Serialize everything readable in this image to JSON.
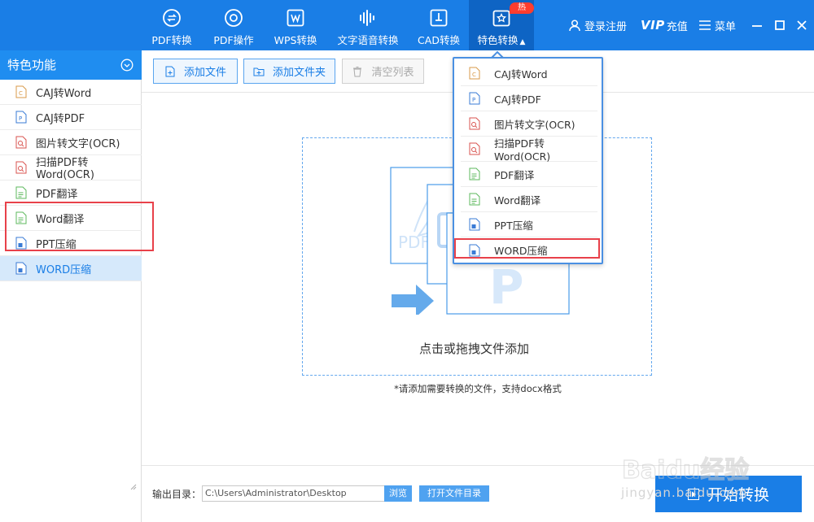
{
  "nav": {
    "items": [
      {
        "label": "PDF转换",
        "icon": "pdf-convert-icon"
      },
      {
        "label": "PDF操作",
        "icon": "pdf-operate-icon"
      },
      {
        "label": "WPS转换",
        "icon": "wps-convert-icon"
      },
      {
        "label": "文字语音转换",
        "icon": "audio-wave-icon"
      },
      {
        "label": "CAD转换",
        "icon": "cad-convert-icon"
      },
      {
        "label": "特色转换",
        "icon": "special-convert-icon"
      }
    ],
    "hot_badge": "热",
    "login": "登录注册",
    "vip": "VIP",
    "recharge": "充值",
    "menu": "菜单"
  },
  "sidebar": {
    "header": "特色功能",
    "items": [
      {
        "label": "CAJ转Word",
        "icon": "caj-file-icon"
      },
      {
        "label": "CAJ转PDF",
        "icon": "caj-pdf-file-icon"
      },
      {
        "label": "图片转文字(OCR)",
        "icon": "ocr-file-icon"
      },
      {
        "label": "扫描PDF转Word(OCR)",
        "icon": "scan-pdf-file-icon"
      },
      {
        "label": "PDF翻译",
        "icon": "pdf-translate-file-icon"
      },
      {
        "label": "Word翻译",
        "icon": "word-translate-file-icon"
      },
      {
        "label": "PPT压缩",
        "icon": "ppt-compress-file-icon"
      },
      {
        "label": "WORD压缩",
        "icon": "word-compress-file-icon"
      }
    ],
    "selected_index": 7
  },
  "toolbar": {
    "add_file": "添加文件",
    "add_folder": "添加文件夹",
    "clear_list": "清空列表"
  },
  "dropzone": {
    "text": "点击或拖拽文件添加",
    "hint": "*请添加需要转换的文件，支持docx格式",
    "illustration_label": "PDF"
  },
  "dropdown": {
    "items": [
      {
        "label": "CAJ转Word"
      },
      {
        "label": "CAJ转PDF"
      },
      {
        "label": "图片转文字(OCR)"
      },
      {
        "label": "扫描PDF转Word(OCR)"
      },
      {
        "label": "PDF翻译"
      },
      {
        "label": "Word翻译"
      },
      {
        "label": "PPT压缩"
      },
      {
        "label": "WORD压缩"
      }
    ]
  },
  "bottom": {
    "output_label": "输出目录：",
    "output_path": "C:\\Users\\Administrator\\Desktop",
    "browse": "浏览",
    "open_folder": "打开文件目录",
    "start": "开始转换"
  },
  "watermark": {
    "text": "jingyan.baidu.com",
    "logo": "Baidu经验"
  },
  "colors": {
    "topbar": "#1a7ee6",
    "accent": "#1f8df0",
    "highlight_red": "#e8414a",
    "selected_bg": "#d6e9fb"
  }
}
